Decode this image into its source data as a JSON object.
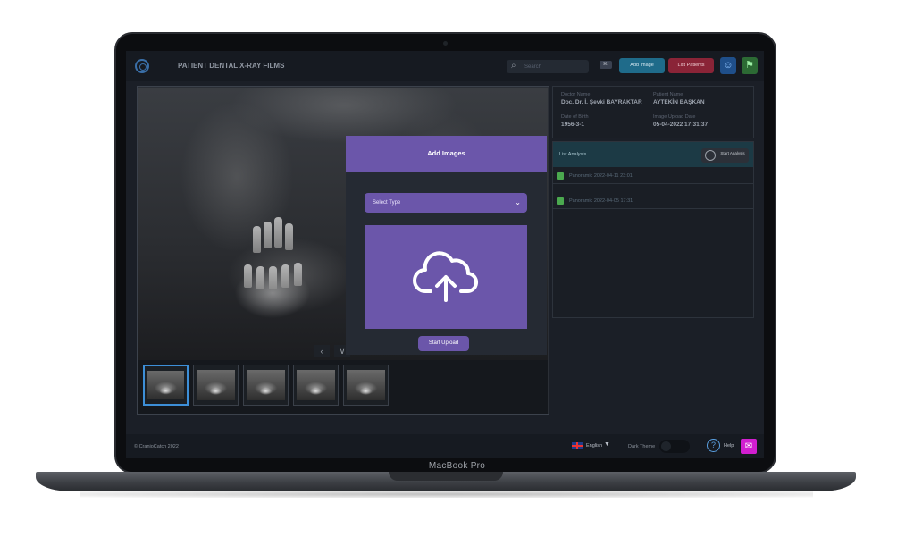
{
  "device": {
    "brand": "MacBook Pro"
  },
  "header": {
    "title": "PATIENT DENTAL X-RAY FILMS",
    "search_placeholder": "Search",
    "shortcut_badge": "⌘/",
    "add_image_label": "Add Image",
    "list_patients_label": "List Patients"
  },
  "viewer": {
    "thumbnail_count": 5,
    "selected_thumbnail": 1
  },
  "modal": {
    "title": "Add Images",
    "select_value": "Select Type",
    "start_upload_label": "Start Upload"
  },
  "patient": {
    "doctor_name_label": "Doctor Name",
    "doctor_name": "Doc. Dr. İ. Şevki BAYRAKTAR",
    "patient_name_label": "Patient Name",
    "patient_name": "AYTEKİN BAŞKAN",
    "dob_label": "Date of Birth",
    "dob": "1956-3-1",
    "upload_date_label": "Image Upload Date",
    "upload_date": "05-04-2022 17:31:37"
  },
  "analysis": {
    "title": "List Analysis",
    "start_label": "Start Analysis",
    "rows": [
      {
        "label": "Panoramic 2022-04-11 23:01"
      },
      {
        "label": "Panoramic 2022-04-05 17:31"
      }
    ]
  },
  "footer": {
    "copyright": "© CranioCatch 2022",
    "language": "English",
    "dark_theme_label": "Dark Theme",
    "help_label": "Help"
  },
  "colors": {
    "accent": "#6b56aa",
    "add_image": "#1f6b8a",
    "list_patients": "#8a2437",
    "status_ok": "#4ba94f",
    "mail": "#d21ed0"
  }
}
